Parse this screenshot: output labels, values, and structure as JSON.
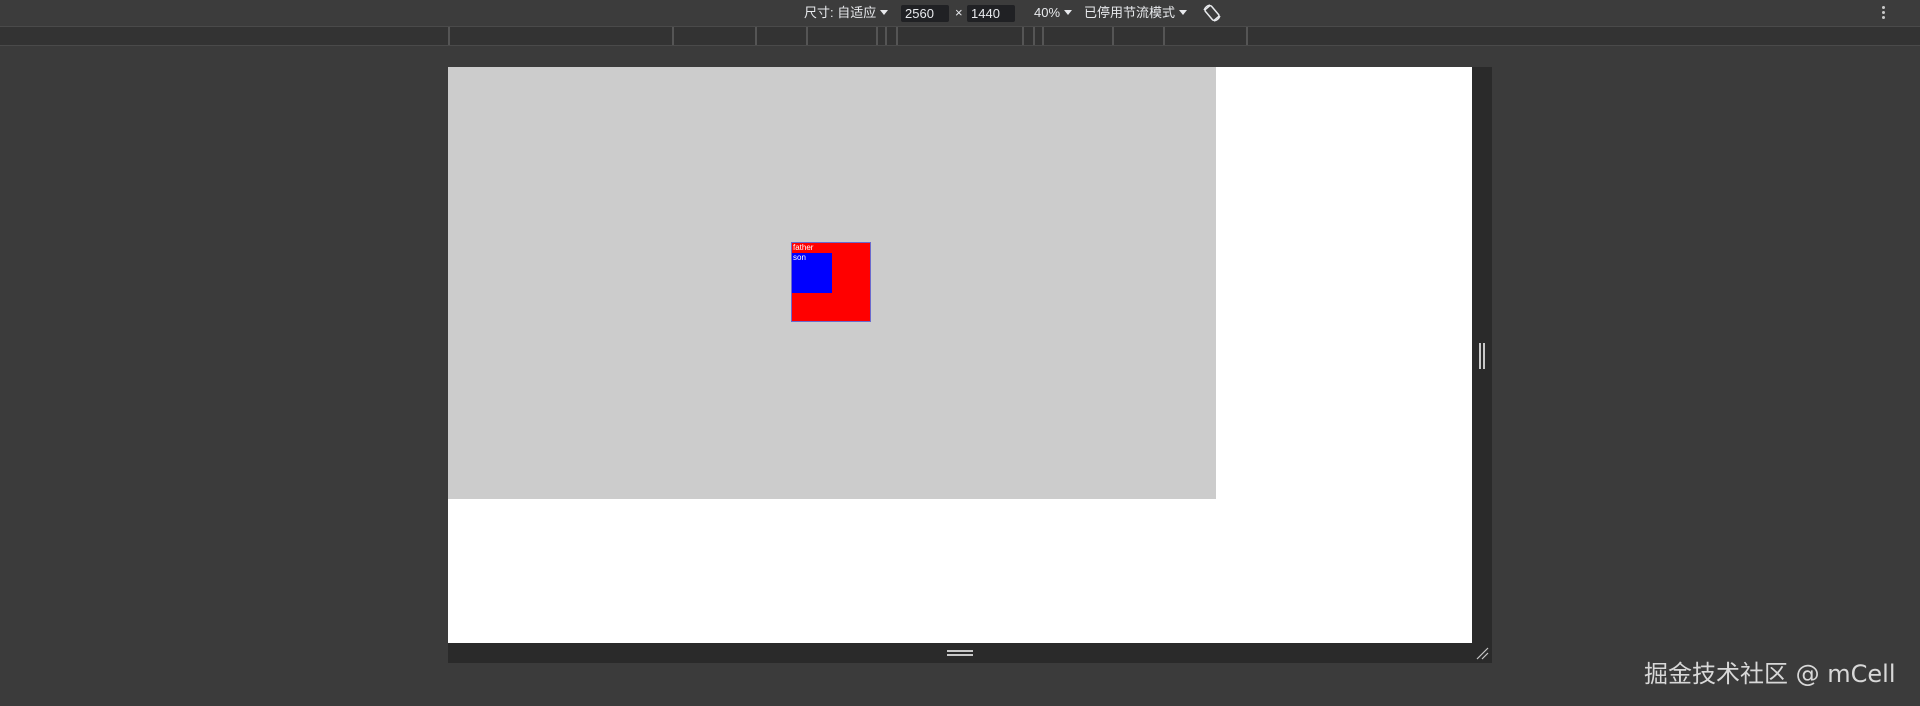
{
  "toolbar": {
    "dimensions_label": "尺寸: 自适应",
    "width": "2560",
    "times": "×",
    "height": "1440",
    "zoom": "40%",
    "throttle": "已停用节流模式"
  },
  "page": {
    "father_label": "father",
    "son_label": "son",
    "colors": {
      "body_bg": "#cccccc",
      "father_bg": "#ff0000",
      "son_bg": "#0000ff",
      "viewport_bg": "#ffffff"
    }
  },
  "icons": {
    "dimensions_caret": "caret-down-icon",
    "zoom_caret": "caret-down-icon",
    "throttle_caret": "caret-down-icon",
    "rotate": "rotate-icon",
    "more": "more-vertical-icon",
    "right_handle": "resize-handle-icon",
    "bottom_handle": "resize-handle-icon",
    "corner_handle": "resize-corner-icon"
  },
  "watermark": "掘金技术社区 @ mCell"
}
